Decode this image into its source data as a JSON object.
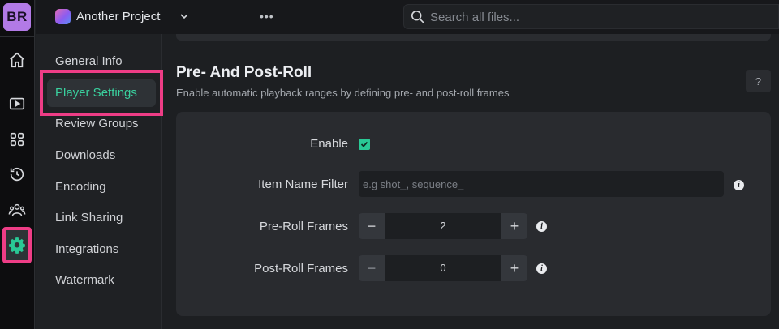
{
  "user": {
    "initials": "BR"
  },
  "rail": {
    "items": [
      {
        "name": "home-icon"
      },
      {
        "name": "play-icon"
      },
      {
        "name": "grid-icon"
      },
      {
        "name": "history-icon"
      },
      {
        "name": "users-icon"
      },
      {
        "name": "gear-icon",
        "active": true
      }
    ]
  },
  "topbar": {
    "project_name": "Another Project",
    "more_label": "•••",
    "search_placeholder": "Search all files..."
  },
  "settings_nav": {
    "items": [
      {
        "label": "General Info"
      },
      {
        "label": "Player Settings",
        "active": true
      },
      {
        "label": "Review Groups"
      },
      {
        "label": "Downloads"
      },
      {
        "label": "Encoding"
      },
      {
        "label": "Link Sharing"
      },
      {
        "label": "Integrations"
      },
      {
        "label": "Watermark"
      }
    ]
  },
  "section": {
    "title": "Pre- And Post-Roll",
    "subtitle": "Enable automatic playback ranges by defining pre- and post-roll frames",
    "help_label": "?"
  },
  "form": {
    "enable_label": "Enable",
    "enable_checked": true,
    "item_name_filter_label": "Item Name Filter",
    "item_name_filter_value": "",
    "item_name_filter_placeholder": "e.g shot_, sequence_",
    "pre_roll_label": "Pre-Roll Frames",
    "pre_roll_value": "2",
    "post_roll_label": "Post-Roll Frames",
    "post_roll_value": "0",
    "minus_label": "−",
    "plus_label": "+",
    "info_label": "i"
  },
  "colors": {
    "accent": "#29c995",
    "highlight": "#ee3d86",
    "avatar": "#b27ae6"
  }
}
